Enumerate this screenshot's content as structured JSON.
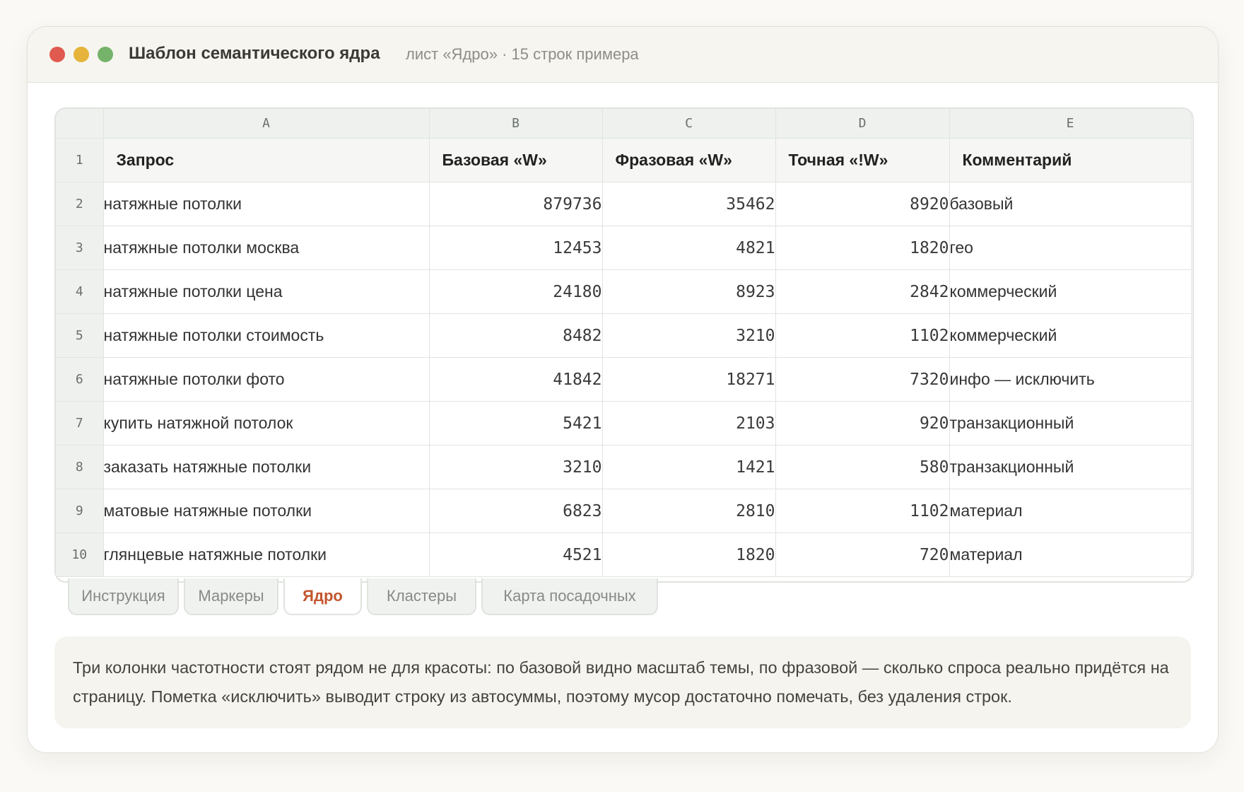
{
  "window": {
    "title": "Шаблон семантического ядра",
    "subtitle": "лист «Ядро» · 15 строк примера",
    "controls": {
      "close_color": "#e05a4f",
      "minimize_color": "#e6b43c",
      "maximize_color": "#75b36a"
    }
  },
  "sheet": {
    "column_letters": [
      "A",
      "B",
      "C",
      "D",
      "E"
    ],
    "header": {
      "row_number": "1",
      "cells": [
        "Запрос",
        "Базовая «W»",
        "Фразовая «W»",
        "Точная «!W»",
        "Комментарий"
      ]
    },
    "rows": [
      {
        "row_number": "2",
        "query": "натяжные потолки",
        "basic": "879736",
        "phrase": "35462",
        "exact": "8920",
        "comment": "базовый"
      },
      {
        "row_number": "3",
        "query": "натяжные потолки москва",
        "basic": "12453",
        "phrase": "4821",
        "exact": "1820",
        "comment": "гео"
      },
      {
        "row_number": "4",
        "query": "натяжные потолки цена",
        "basic": "24180",
        "phrase": "8923",
        "exact": "2842",
        "comment": "коммерческий"
      },
      {
        "row_number": "5",
        "query": "натяжные потолки стоимость",
        "basic": "8482",
        "phrase": "3210",
        "exact": "1102",
        "comment": "коммерческий"
      },
      {
        "row_number": "6",
        "query": "натяжные потолки фото",
        "basic": "41842",
        "phrase": "18271",
        "exact": "7320",
        "comment": "инфо — исключить"
      },
      {
        "row_number": "7",
        "query": "купить натяжной потолок",
        "basic": "5421",
        "phrase": "2103",
        "exact": "920",
        "comment": "транзакционный"
      },
      {
        "row_number": "8",
        "query": "заказать натяжные потолки",
        "basic": "3210",
        "phrase": "1421",
        "exact": "580",
        "comment": "транзакционный"
      },
      {
        "row_number": "9",
        "query": "матовые натяжные потолки",
        "basic": "6823",
        "phrase": "2810",
        "exact": "1102",
        "comment": "материал"
      },
      {
        "row_number": "10",
        "query": "глянцевые натяжные потолки",
        "basic": "4521",
        "phrase": "1820",
        "exact": "720",
        "comment": "материал"
      }
    ]
  },
  "tabs": [
    {
      "label": "Инструкция",
      "active": false
    },
    {
      "label": "Маркеры",
      "active": false
    },
    {
      "label": "Ядро",
      "active": true
    },
    {
      "label": "Кластеры",
      "active": false
    },
    {
      "label": "Карта посадочных",
      "active": false
    }
  ],
  "note": {
    "text": "Три колонки частотности стоят рядом не для красоты: по базовой видно масштаб темы, по фразовой — сколько спроса реально придётся на страницу. Пометка «исключить» выводит строку из автосуммы, поэтому мусор достаточно помечать, без удаления строк."
  },
  "colors": {
    "active_tab": "#c4552e",
    "header_bg": "#eef1ee"
  }
}
